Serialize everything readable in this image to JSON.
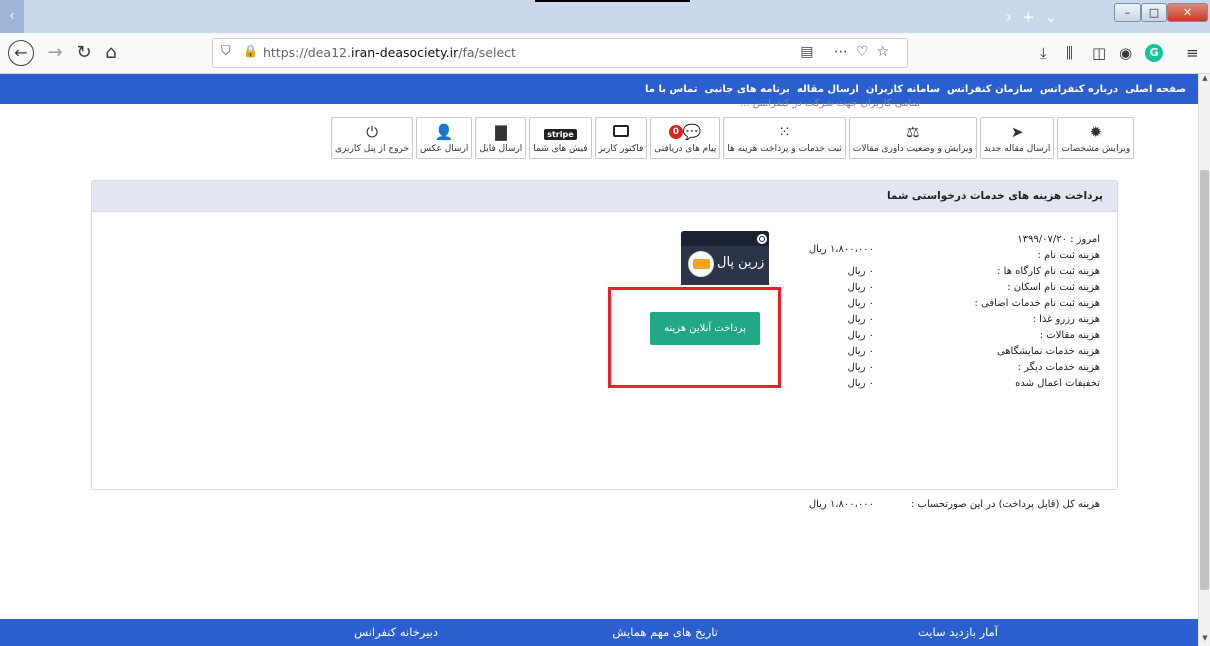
{
  "browser": {
    "url_prefix": "https://dea12.",
    "url_host": "iran-deasociety.ir",
    "url_path": "/fa/select"
  },
  "site_nav": [
    "صفحه اصلی",
    "درباره کنفرانس",
    "سازمان کنفرانس",
    "سامانه کاربران",
    "ارسال مقاله",
    "برنامه های جانبی",
    "تماس با ما"
  ],
  "hidden_text": "تمامی کاربران جهت شرکت در کنفرانس ...",
  "dashboard": [
    {
      "label": "ویرایش مشخصات",
      "icon": "gear-icon",
      "glyph": "✹"
    },
    {
      "label": "ارسال مقاله جدید",
      "icon": "paper-plane-icon",
      "glyph": "➤"
    },
    {
      "label": "ویرایش و وضعیت داوری مقالات",
      "icon": "balance-scale-icon",
      "glyph": "⚖"
    },
    {
      "label": "ثبت خدمات و پرداخت هزینه ها",
      "icon": "spinner-icon",
      "glyph": "⁙"
    },
    {
      "label": "پیام های دریافتی",
      "icon": "messages-icon",
      "glyph": "💬",
      "badge": "0"
    },
    {
      "label": "فاکتور کاربر",
      "icon": "credit-card-icon",
      "glyph": ""
    },
    {
      "label": "فیش های شما",
      "icon": "stripe-icon",
      "glyph": "stripe"
    },
    {
      "label": "ارسال فایل",
      "icon": "file-icon",
      "glyph": "▇"
    },
    {
      "label": "ارسال عکس",
      "icon": "user-icon",
      "glyph": "👤"
    },
    {
      "label": "خروج از پنل کاربری",
      "icon": "power-icon",
      "glyph": "⏻"
    }
  ],
  "panel": {
    "title": "پرداخت هزینه های خدمات درخواستی شما",
    "today_label": "امروز : ۱۳۹۹/۰۷/۲۰",
    "fees": [
      {
        "label": "هزینه ثبت نام :",
        "value": "۱،۸۰۰،۰۰۰ ریال"
      },
      {
        "label": "هزینه ثبت نام کارگاه ها :",
        "value": "۰ ریال"
      },
      {
        "label": "هزینه ثبت نام اسکان :",
        "value": "۰ ریال"
      },
      {
        "label": "هزینه ثبت نام خدمات اضافی :",
        "value": "۰ ریال"
      },
      {
        "label": "هزینه رزرو غذا :",
        "value": "۰ ریال"
      },
      {
        "label": "هزینه مقالات :",
        "value": "۰ ریال"
      },
      {
        "label": "هزینه خدمات نمایشگاهی",
        "value": "۰ ریال"
      },
      {
        "label": "هزینه خدمات دیگر :",
        "value": "۰ ریال"
      },
      {
        "label": "تخفیفات اعمال شده",
        "value": "۰ ریال"
      }
    ],
    "total_label": "هزینه کل (قابل پرداخت) در این صورتحساب :",
    "total_value": "۱،۸۰۰،۰۰۰ ریال",
    "gateway_name": "زرین پال",
    "pay_button": "پرداخت آنلاین هزینه"
  },
  "footer": {
    "col1": "آمار بازدید سایت",
    "col2": "تاریخ های مهم همایش",
    "col3": "دبیرخانه کنفرانس"
  },
  "colors": {
    "site_blue": "#2b5fcf",
    "pay_green": "#22a887",
    "highlight_red": "#e8212a"
  }
}
